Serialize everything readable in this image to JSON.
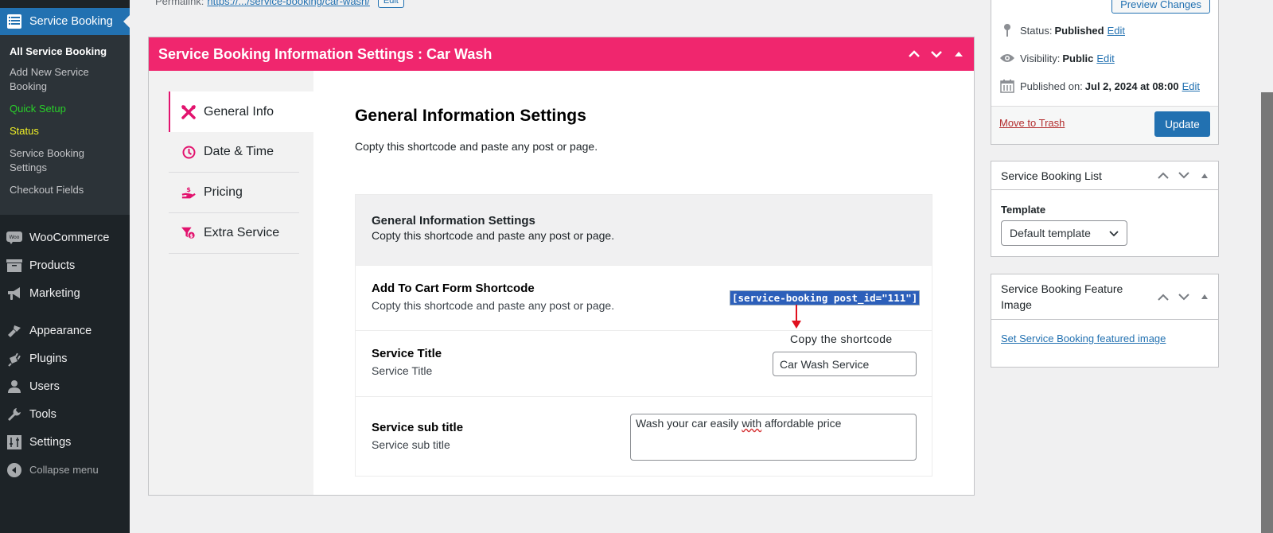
{
  "sidebar": {
    "active_menu": {
      "label": "Service Booking",
      "icon": "list-icon"
    },
    "submenu": [
      {
        "label": "All Service Booking",
        "style": "current"
      },
      {
        "label": "Add New Service Booking",
        "style": "normal"
      },
      {
        "label": "Quick Setup",
        "style": "green"
      },
      {
        "label": "Status",
        "style": "yellow"
      },
      {
        "label": "Service Booking Settings",
        "style": "normal"
      },
      {
        "label": "Checkout Fields",
        "style": "normal"
      }
    ],
    "menu": [
      {
        "label": "WooCommerce",
        "icon": "woo-icon"
      },
      {
        "label": "Products",
        "icon": "archive-icon"
      },
      {
        "label": "Marketing",
        "icon": "megaphone-icon"
      },
      {
        "label": "Appearance",
        "icon": "paintbrush-icon"
      },
      {
        "label": "Plugins",
        "icon": "plug-icon"
      },
      {
        "label": "Users",
        "icon": "user-icon"
      },
      {
        "label": "Tools",
        "icon": "wrench-icon"
      },
      {
        "label": "Settings",
        "icon": "sliders-icon"
      }
    ],
    "collapse_label": "Collapse menu"
  },
  "permalink": {
    "label": "Permalink:",
    "url_text": "https://.../service-booking/car-wash/",
    "edit_label": "Edit"
  },
  "mainbox": {
    "title": "Service Booking Information Settings : Car Wash",
    "accent_color": "#f0266e",
    "tabs": [
      {
        "label": "General Info",
        "icon": "tools-icon",
        "active": true
      },
      {
        "label": "Date & Time",
        "icon": "clock-icon",
        "active": false
      },
      {
        "label": "Pricing",
        "icon": "hand-dollar-icon",
        "active": false
      },
      {
        "label": "Extra Service",
        "icon": "funnel-dollar-icon",
        "active": false
      }
    ],
    "section_title": "General Information Settings",
    "section_desc": "Copty this shortcode and paste any post or page.",
    "settings_box": {
      "head_title": "General Information Settings",
      "head_desc": "Copty this shortcode and paste any post or page.",
      "shortcode_row": {
        "label": "Add To Cart Form Shortcode",
        "desc": "Copty this shortcode and paste any post or page.",
        "shortcode": "[service-booking post_id=\"111\"]"
      },
      "annotation": "Copy the shortcode",
      "title_row": {
        "label": "Service Title",
        "desc": "Service Title",
        "value": "Car Wash Service"
      },
      "subtitle_row": {
        "label": "Service sub title",
        "desc": "Service sub title",
        "value_pre": "Wash your car easily ",
        "value_misspelled": "with",
        "value_post": " affordable price"
      }
    }
  },
  "publish": {
    "preview_label": "Preview Changes",
    "status_label": "Status:",
    "status_value": "Published",
    "visibility_label": "Visibility:",
    "visibility_value": "Public",
    "published_label": "Published on:",
    "published_value": "Jul 2, 2024 at 08:00",
    "edit_label": "Edit",
    "trash_label": "Move to Trash",
    "update_label": "Update"
  },
  "list_box": {
    "title": "Service Booking List",
    "template_label": "Template",
    "template_value": "Default template"
  },
  "feature_box": {
    "title": "Service Booking Feature Image",
    "link": "Set Service Booking featured image"
  }
}
